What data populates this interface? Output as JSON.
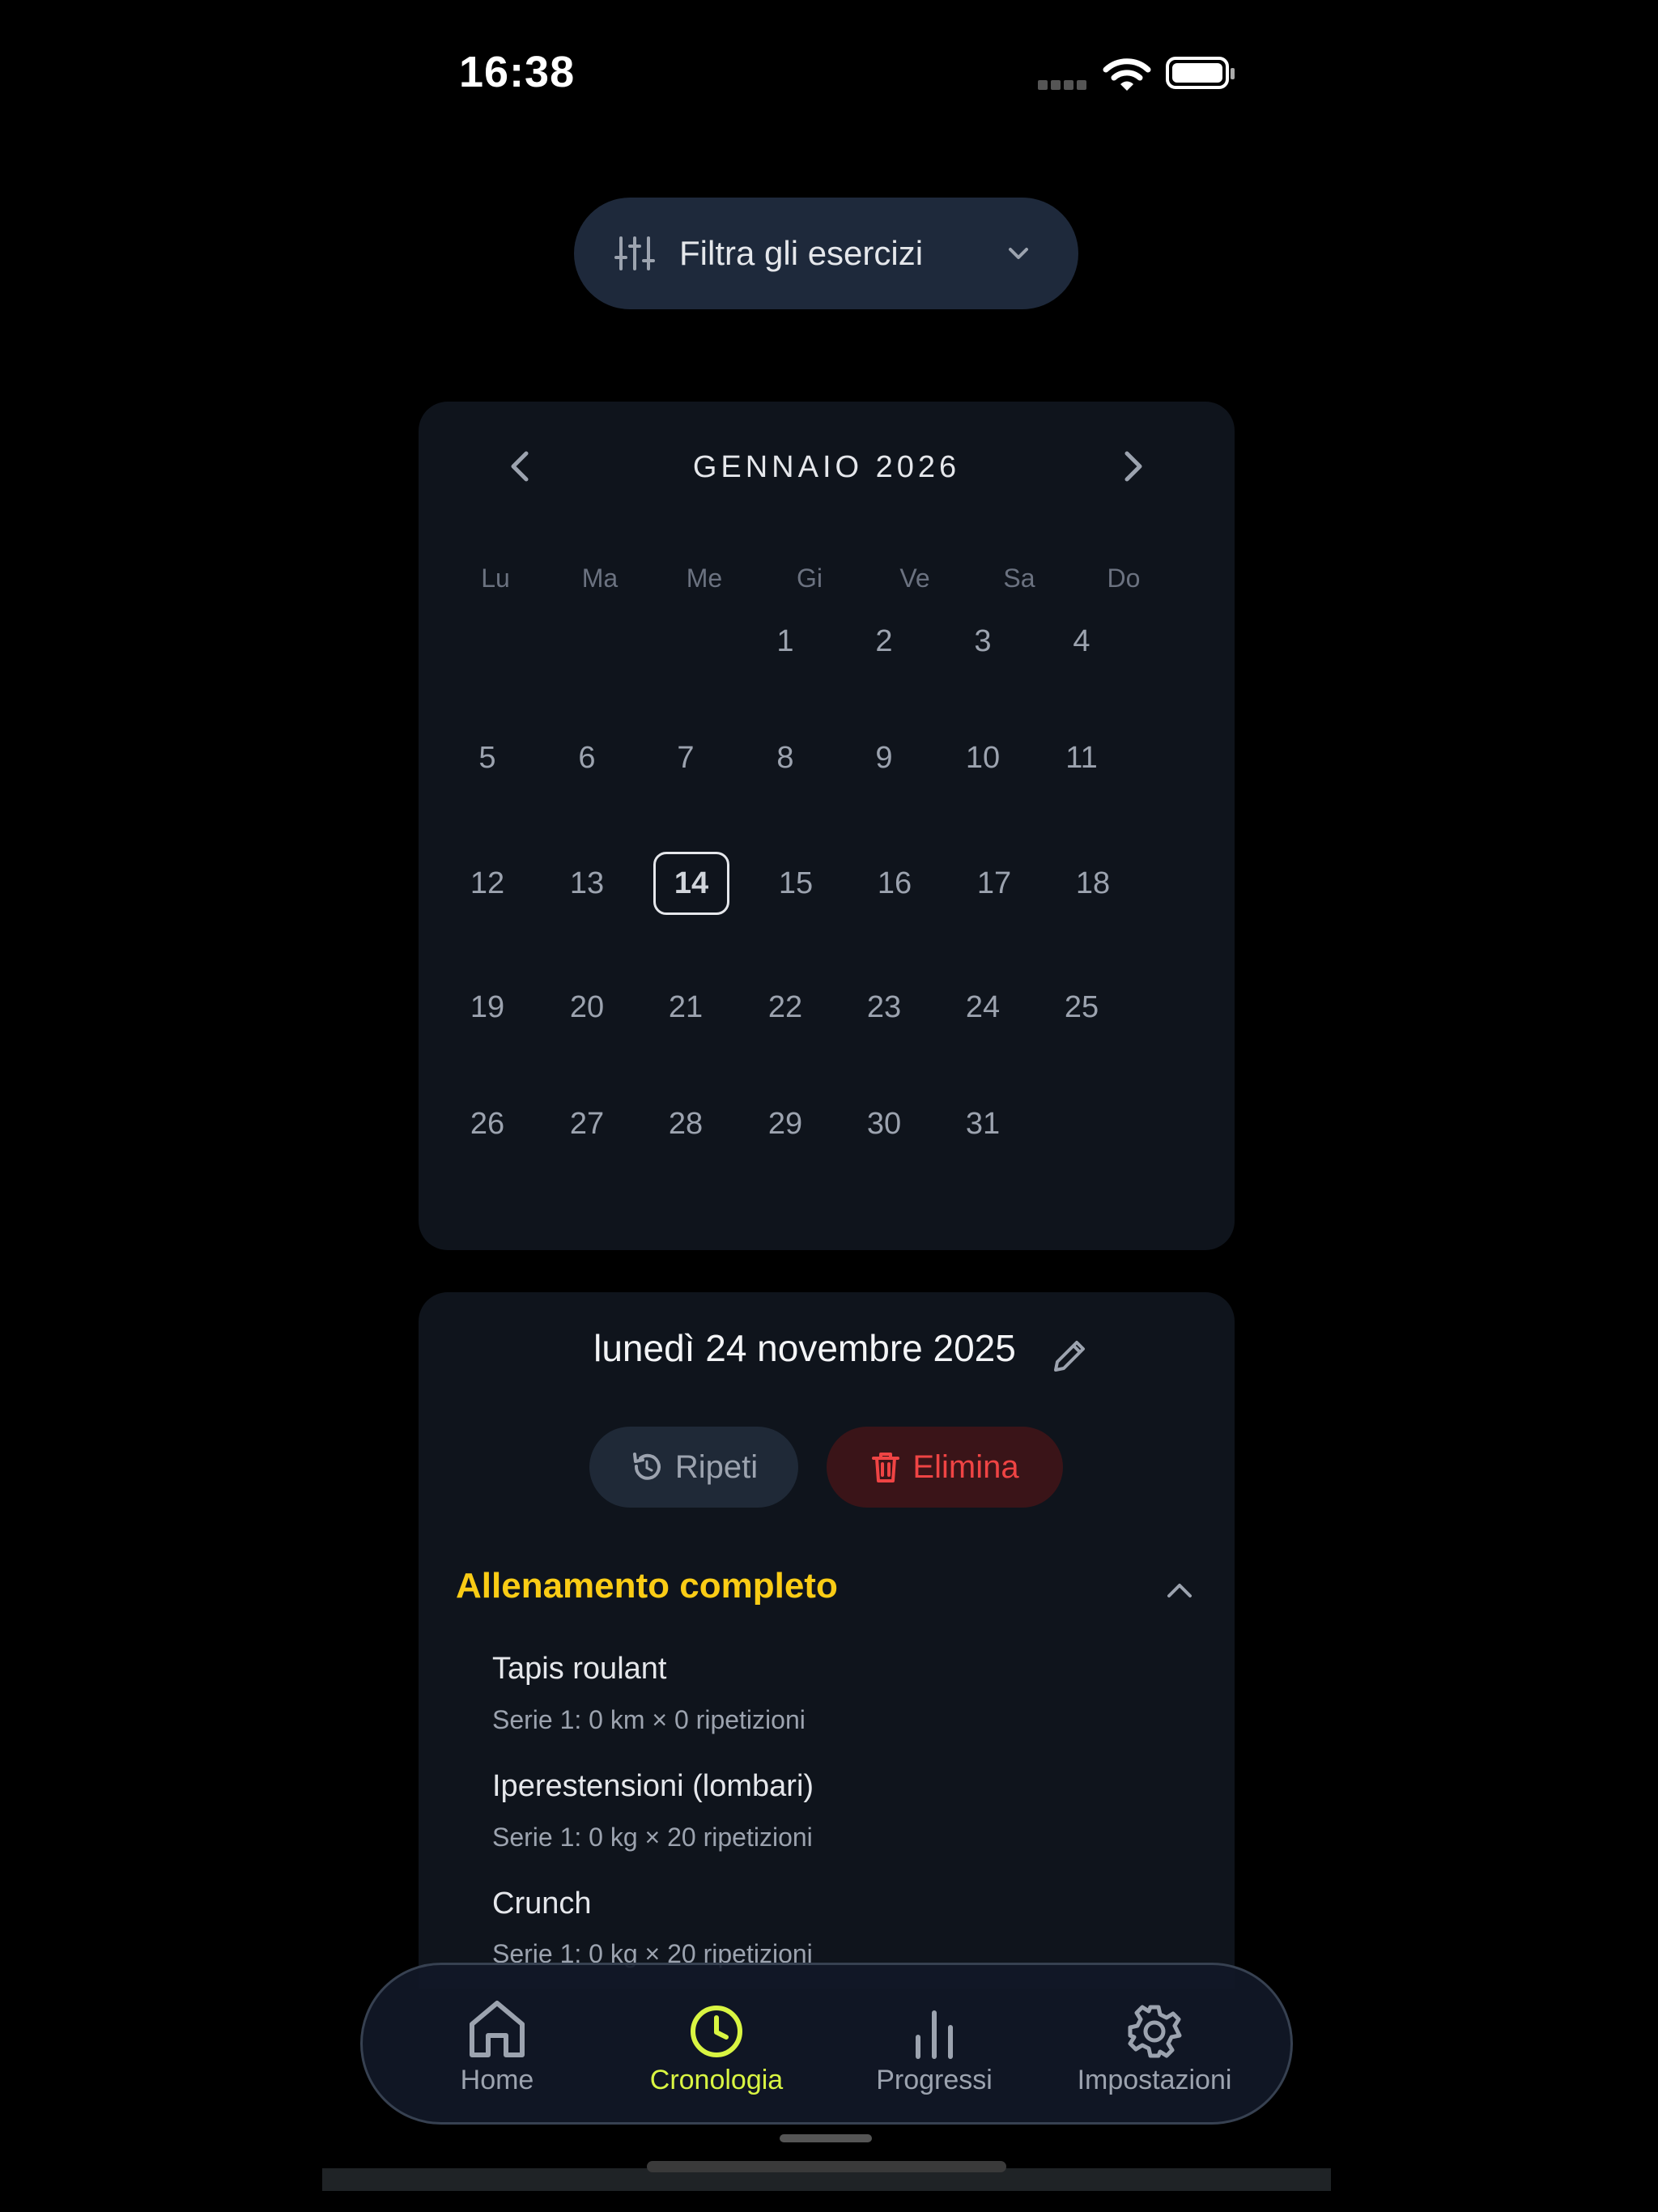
{
  "status_bar": {
    "time": "16:38"
  },
  "filter": {
    "label": "Filtra gli esercizi"
  },
  "calendar": {
    "month_label": "GENNAIO 2026",
    "weekdays": [
      "Lu",
      "Ma",
      "Me",
      "Gi",
      "Ve",
      "Sa",
      "Do"
    ],
    "selected_day": "14",
    "days": [
      "1",
      "2",
      "3",
      "4",
      "5",
      "6",
      "7",
      "8",
      "9",
      "10",
      "11",
      "12",
      "13",
      "14",
      "15",
      "16",
      "17",
      "18",
      "19",
      "20",
      "21",
      "22",
      "23",
      "24",
      "25",
      "26",
      "27",
      "28",
      "29",
      "30",
      "31"
    ]
  },
  "session": {
    "date": "lunedì 24 novembre 2025",
    "repeat_label": "Ripeti",
    "delete_label": "Elimina",
    "group_title": "Allenamento completo",
    "exercises": [
      {
        "name": "Tapis roulant",
        "detail": "Serie 1: 0 km × 0 ripetizioni"
      },
      {
        "name": "Iperestensioni (lombari)",
        "detail": "Serie 1: 0 kg × 20 ripetizioni"
      },
      {
        "name": "Crunch",
        "detail": "Serie 1: 0 kg × 20 ripetizioni"
      }
    ]
  },
  "tabs": [
    {
      "label": "Home",
      "icon": "home-icon"
    },
    {
      "label": "Cronologia",
      "icon": "clock-icon"
    },
    {
      "label": "Progressi",
      "icon": "bar-chart-icon"
    },
    {
      "label": "Impostazioni",
      "icon": "gear-icon"
    }
  ],
  "colors": {
    "accent": "#d9f542",
    "group_title": "#facc15",
    "danger": "#ef4444",
    "card": "#0f141c"
  }
}
